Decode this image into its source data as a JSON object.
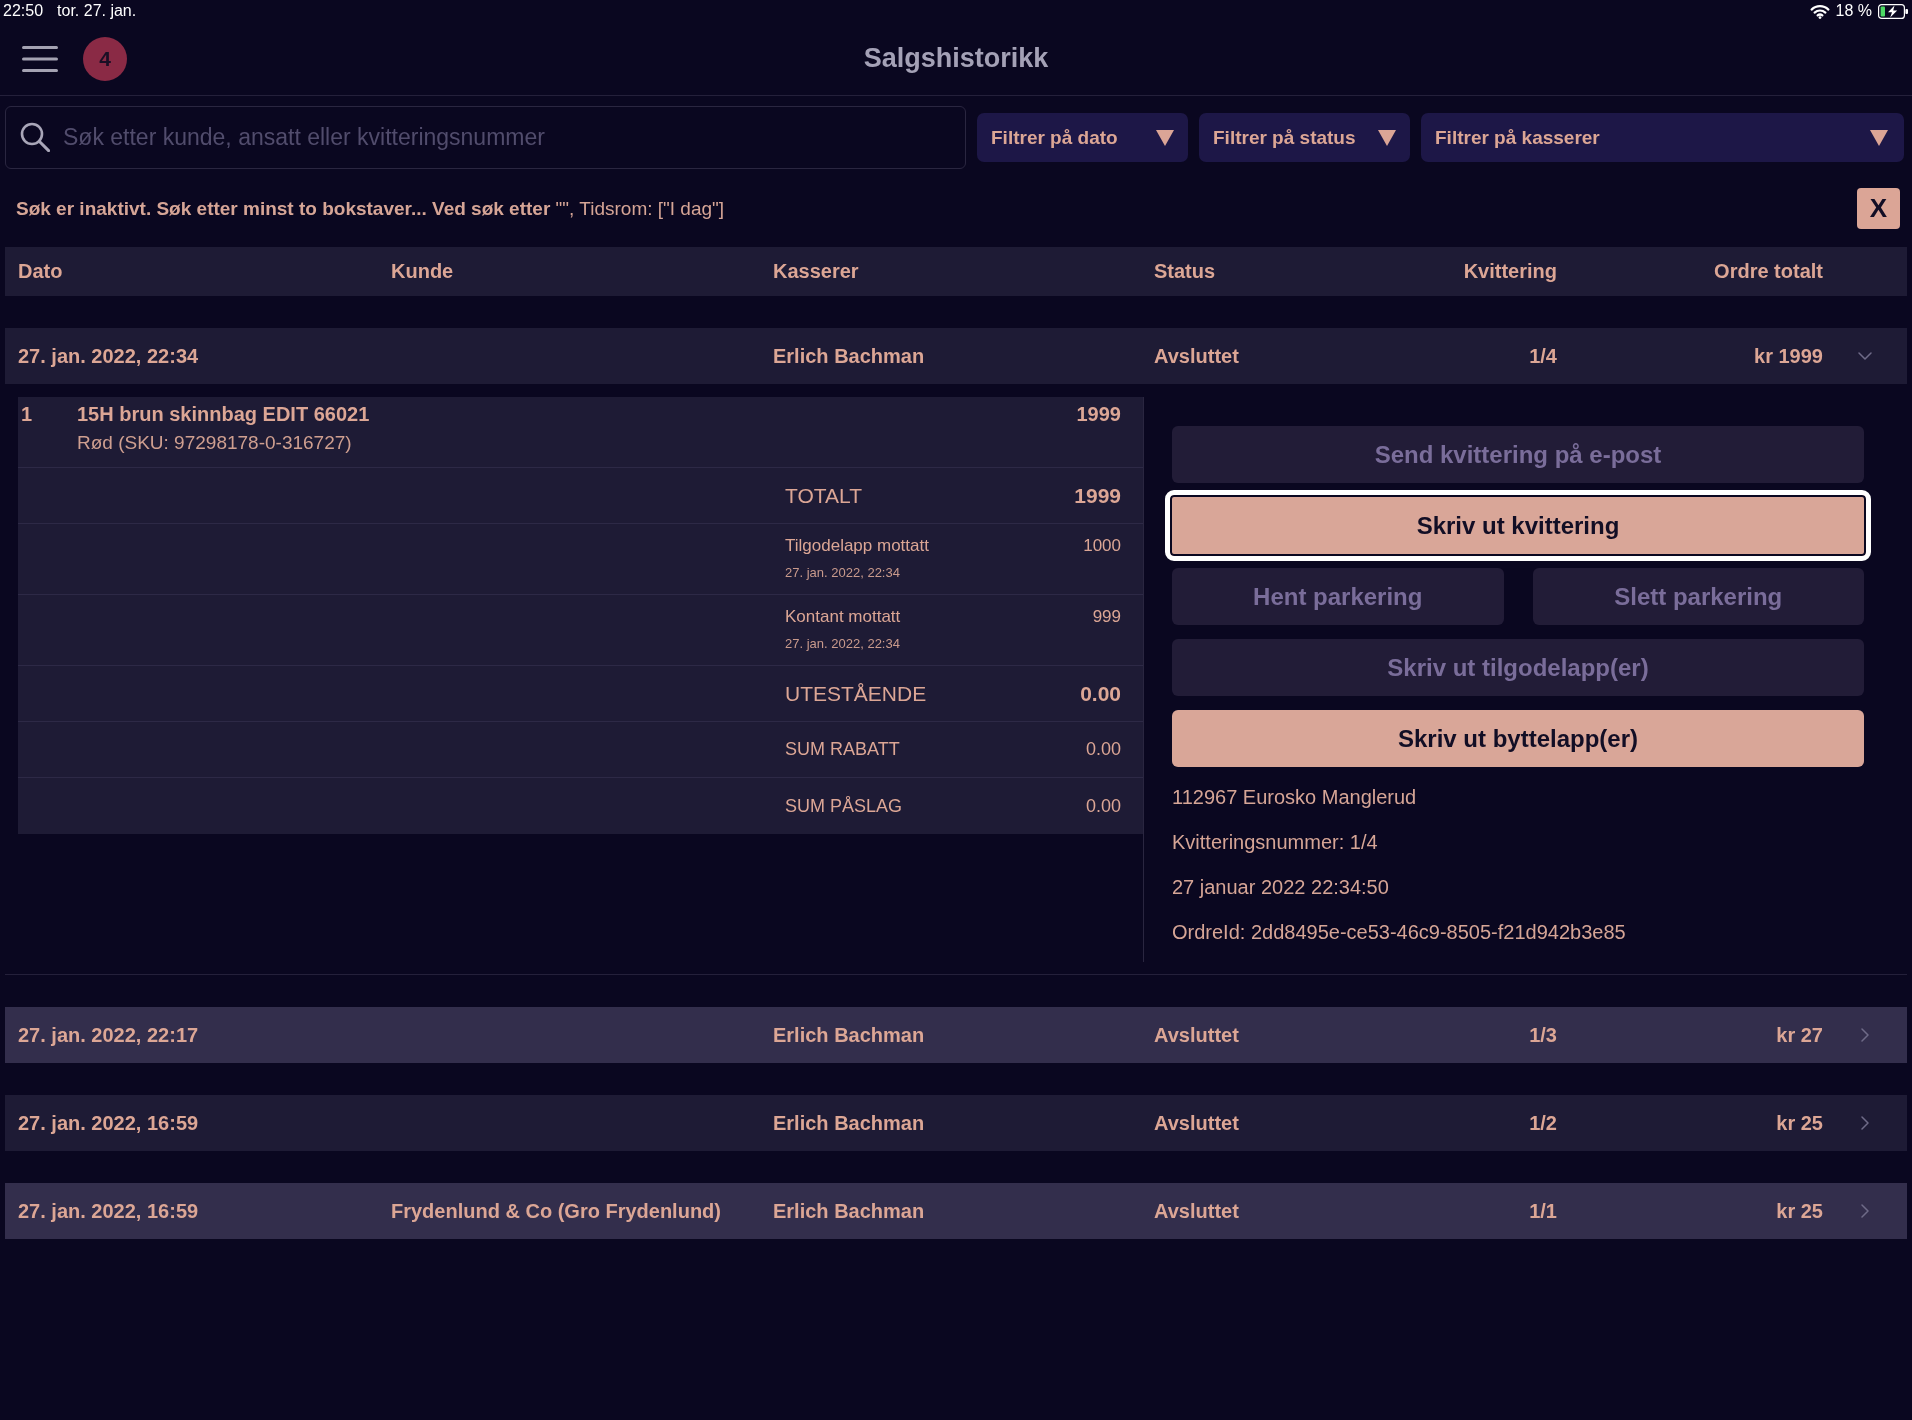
{
  "status_bar": {
    "time": "22:50",
    "date": "tor. 27. jan.",
    "battery": "18 %"
  },
  "header": {
    "title": "Salgshistorikk",
    "badge": "4"
  },
  "search": {
    "placeholder": "Søk etter kunde, ansatt eller kvitteringsnummer"
  },
  "filters": [
    {
      "label": "Filtrer på dato"
    },
    {
      "label": "Filtrer på status"
    },
    {
      "label": "Filtrer på kasserer"
    }
  ],
  "notice": {
    "text": "**Søk er inaktivt. Søk etter minst to bokstaver... Ved søk etter** \"\", Tidsrom: [\"I dag\"]",
    "close_label": "X"
  },
  "table": {
    "columns": [
      "Dato",
      "Kunde",
      "Kasserer",
      "Status",
      "Kvittering",
      "Ordre totalt"
    ],
    "rows": [
      {
        "date": "27. jan. 2022, 22:34",
        "cashier": "Erlich Bachman",
        "status": "Avsluttet",
        "receipt": "1/4",
        "total": "kr 1999",
        "expanded": true,
        "details": {
          "items": [
            {
              "qty": "1",
              "name": "15H brun skinnbag EDIT 66021",
              "variant": "Rød (SKU: 97298178-0-316727)",
              "amount": "1999"
            }
          ],
          "summary": [
            {
              "kind": "total",
              "label": "TOTALT",
              "value": "1999"
            },
            {
              "kind": "payment",
              "label": "Tilgodelapp mottatt",
              "date": "27. jan. 2022, 22:34",
              "value": "1000"
            },
            {
              "kind": "payment",
              "label": "Kontant mottatt",
              "date": "27. jan. 2022, 22:34",
              "value": "999"
            },
            {
              "kind": "total",
              "label": "UTESTÅENDE",
              "value": "0.00"
            },
            {
              "kind": "sum",
              "label": "SUM RABATT",
              "value": "0.00"
            },
            {
              "kind": "sum",
              "label": "SUM PÅSLAG",
              "value": "0.00"
            }
          ],
          "action_rows": [
            {
              "buttons": [
                {
                  "label": "Send kvittering på e-post",
                  "disabled": true,
                  "focused": false
                }
              ]
            },
            {
              "buttons": [
                {
                  "label": "Skriv ut kvittering",
                  "disabled": false,
                  "focused": true
                }
              ]
            },
            {
              "buttons": [
                {
                  "label": "Hent parkering",
                  "disabled": true,
                  "focused": false
                },
                {
                  "label": "Slett parkering",
                  "disabled": true,
                  "focused": false
                }
              ]
            },
            {
              "buttons": [
                {
                  "label": "Skriv ut tilgodelapp(er)",
                  "disabled": true,
                  "focused": false
                }
              ]
            },
            {
              "buttons": [
                {
                  "label": "Skriv ut byttelapp(er)",
                  "disabled": false,
                  "focused": false
                }
              ]
            }
          ],
          "info": [
            "112967 Eurosko Manglerud",
            "Kvitteringsnummer: 1/4",
            "27 januar 2022 22:34:50",
            "OrdreId: 2dd8495e-ce53-46c9-8505-f21d942b3e85"
          ]
        }
      },
      {
        "date": "27. jan. 2022, 22:17",
        "cashier": "Erlich Bachman",
        "status": "Avsluttet",
        "receipt": "1/3",
        "total": "kr 27",
        "expanded": false
      },
      {
        "date": "27. jan. 2022, 16:59",
        "cashier": "Erlich Bachman",
        "status": "Avsluttet",
        "receipt": "1/2",
        "total": "kr 25",
        "expanded": false
      },
      {
        "date": "27. jan. 2022, 16:59",
        "customer": "Frydenlund & Co (Gro Frydenlund)",
        "cashier": "Erlich Bachman",
        "status": "Avsluttet",
        "receipt": "1/1",
        "total": "kr 25",
        "expanded": false
      }
    ]
  }
}
